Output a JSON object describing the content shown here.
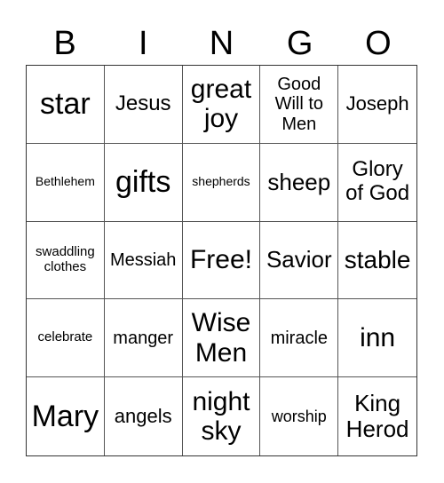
{
  "header": [
    "B",
    "I",
    "N",
    "G",
    "O"
  ],
  "cells": [
    "star",
    "Jesus",
    "great joy",
    "Good Will to Men",
    "Joseph",
    "Bethlehem",
    "gifts",
    "shepherds",
    "sheep",
    "Glory of God",
    "swaddling clothes",
    "Messiah",
    "Free!",
    "Savior",
    "stable",
    "celebrate",
    "manger",
    "Wise Men",
    "miracle",
    "inn",
    "Mary",
    "angels",
    "night sky",
    "worship",
    "King Herod"
  ]
}
